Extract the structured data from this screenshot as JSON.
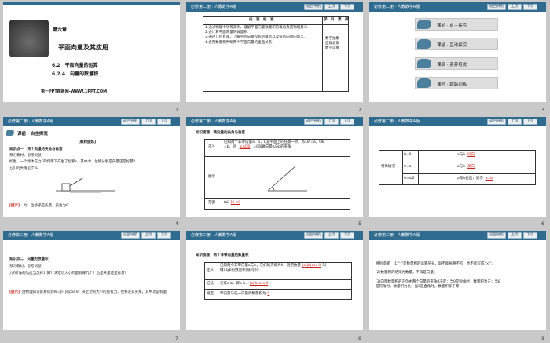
{
  "common": {
    "header_title": "必修第二册 · 人教数学A版",
    "nav_back": "返回导航",
    "nav_prev": "上页",
    "nav_next": "下页"
  },
  "slide1": {
    "chapter": "第六章",
    "chapter_sub": "",
    "title": "平面向量及其应用",
    "section1": "6.2　平面向量的运算",
    "section2": "6.2.4　向量的数量积",
    "footer": "第一PPT模板网-WWW.1PPT.COM",
    "number": "1"
  },
  "slide2": {
    "col1_header": "内　容　标　准",
    "col2_header": "学　科　素　养",
    "items": [
      "1.通过物理中功等实例，理解平面向量数量积的概念及其物理意义.",
      "2.会计算平面向量的数量积.",
      "3.通过几何直观，了解平面向量投影的概念以及投影向量的意义.",
      "4.会用数量积判断两个平面向量的垂直关系."
    ],
    "literacy": [
      "数学抽象",
      "直观想象",
      "数学运算"
    ],
    "number": "2"
  },
  "slide3": {
    "menu": [
      "课前 · 自主探究",
      "课堂 · 互动探究",
      "课后 · 素养培优",
      "课时 · 跟踪训练"
    ],
    "number": "3"
  },
  "slide4": {
    "heading": "课前 · 自主探究",
    "heading_right": "",
    "tag": "[教材提炼]",
    "kp": "知识点一　两个向量的夹角与垂直",
    "l1": "预习教材，思考问题",
    "l2": "如图，一个物体在力F的作用下产生了位移s，其中力、位移分别是矢量还是标量？",
    "l3": "它们的夹角是什么？",
    "hint_label": "[提示]",
    "hint": "力、位移都是矢量，夹角为θ",
    "number": "4"
  },
  "slide5": {
    "title": "知识梳理　两向量的夹角与垂直",
    "r1_label": "定义",
    "r1_a": "已知两个非零向量a，b，O是平面上的任意一点，作OA=a，OB",
    "r1_b": "=b，则",
    "r1_fill": "∠AOB",
    "r1_c": "=θ叫做向量a与b的夹角",
    "r2_label": "图示",
    "r3_label": "范围",
    "r3_a": "θ∈",
    "r3_fill": "[0, π]",
    "number": "5"
  },
  "slide6": {
    "special": "特殊情况",
    "rows": [
      {
        "cond": "θ=0",
        "a": "a与b",
        "fill": "同向",
        "b": ""
      },
      {
        "cond": "θ=π",
        "a": "a与b",
        "fill": "反向",
        "b": ""
      },
      {
        "cond": "θ=π/2",
        "a": "a与b垂直，记作",
        "fill": "a⊥b",
        "b": ""
      }
    ],
    "number": "6"
  },
  "slide7": {
    "kp": "知识点二　向量的数量积",
    "l1": "预习教材，思考问题",
    "l2": "力F所做的功应当怎样计算？决定功大小的量有哪几个？功是矢量还是标量？",
    "hint_label": "[提示]",
    "hint": "由物理知识容易得到W=|F||s|cos θ，决定功的大小的量有力、位移及其夹角，其中功是标量.",
    "number": "7"
  },
  "slide8": {
    "title": "知识梳理　两个非零向量的数量积",
    "r1_label": "定义",
    "r1_a": "已知两个非零向量a与b，它们的夹角为θ，则把数量",
    "r1_fill": "|a||b|cos θ",
    "r1_b": "叫",
    "r1_c": "做a与b的数量积(或内积)",
    "r2_label": "记法",
    "r2_a": "记作a·b，即a·b=",
    "r2_fill": "|a||b|cos θ",
    "r3_label": "规定",
    "r3_a": "零向量与任一向量的数量积为",
    "r3_fill": "0",
    "number": "8"
  },
  "slide9": {
    "l1": "特别提醒　(1)“·”是数量积的运算符号，既不能省略不写，也不能写成“×”；",
    "l2": "(2)数量积的结果为数量，不再是向量；",
    "l3": "(3)向量数量积的正负由两个向量的夹角θ决定：当θ是锐角时，数量积为正；当θ",
    "l4": "是钝角时，数量积为负；当θ是直角时，数量积等于零.",
    "number": "9"
  }
}
